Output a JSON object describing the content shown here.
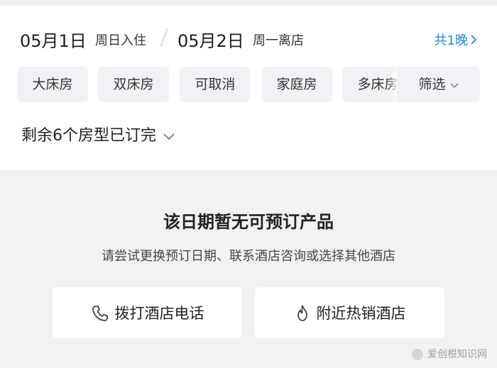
{
  "date_bar": {
    "checkin_date": "05月1日",
    "checkin_day": "周日入住",
    "checkout_date": "05月2日",
    "checkout_day": "周一离店",
    "nights": "共1晚",
    "nights_color": "#1a8bd6"
  },
  "filters": {
    "chips": [
      "大床房",
      "双床房",
      "可取消",
      "家庭房",
      "多床房"
    ],
    "filter_label": "筛选"
  },
  "soldout": {
    "text": "剩余6个房型已订完"
  },
  "empty_state": {
    "title": "该日期暂无可预订产品",
    "subtitle": "请尝试更换预订日期、联系酒店咨询或选择其他酒店",
    "call_button": "拨打酒店电话",
    "nearby_button": "附近热销酒店"
  },
  "watermark": {
    "text": "爱创根知识网"
  },
  "icons": {
    "phone": "phone-icon",
    "flame": "flame-icon",
    "chevron": "chevron-icon"
  }
}
